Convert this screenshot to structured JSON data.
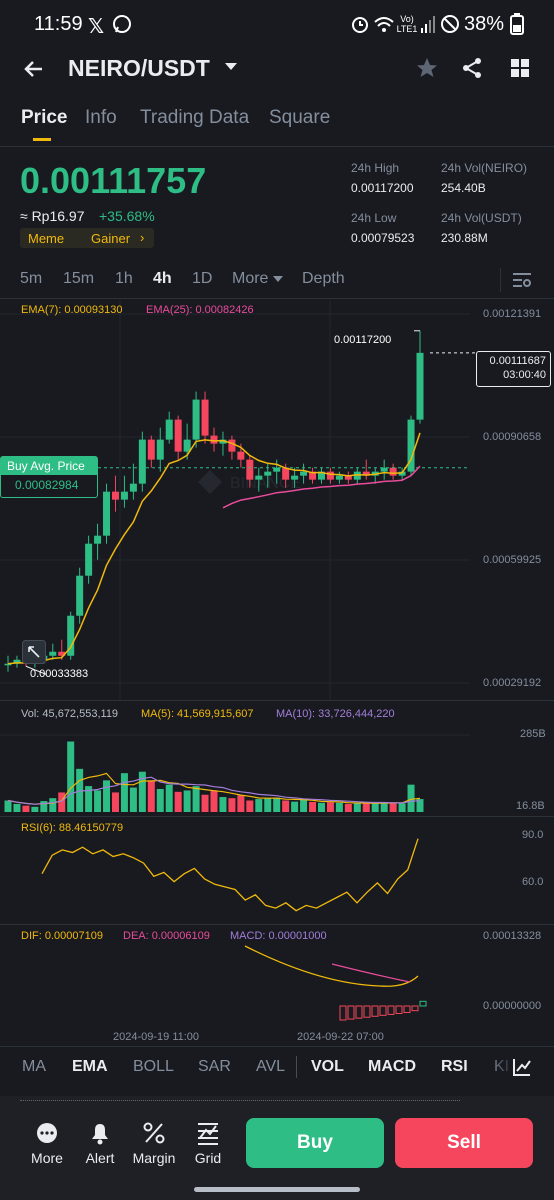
{
  "status_bar": {
    "time": "11:59",
    "net_label": "Vo) LTE1",
    "battery": "38%"
  },
  "header": {
    "pair": "NEIRO/USDT"
  },
  "tabs": [
    "Price",
    "Info",
    "Trading Data",
    "Square"
  ],
  "ticker": {
    "price": "0.00111757",
    "approx": "≈ Rp16.97",
    "change": "+35.68%",
    "tag_meme": "Meme",
    "tag_gainer": "Gainer",
    "high_label": "24h High",
    "high": "0.00117200",
    "vol_base_label": "24h Vol(NEIRO)",
    "vol_base": "254.40B",
    "low_label": "24h Low",
    "low": "0.00079523",
    "vol_quote_label": "24h Vol(USDT)",
    "vol_quote": "230.88M"
  },
  "intervals": [
    "5m",
    "15m",
    "1h",
    "4h",
    "1D",
    "More",
    "Depth"
  ],
  "main_chart": {
    "ema7": "EMA(7): 0.00093130",
    "ema25": "EMA(25): 0.00082426",
    "axis": [
      "0.00121391",
      "0.00090658",
      "0.00059925",
      "0.00029192"
    ],
    "high_marker": "0.00117200",
    "low_marker": "0.00033383",
    "last_price": "0.00111687",
    "countdown": "03:00:40",
    "buy_avg_label": "Buy Avg. Price",
    "buy_avg_value": "0.00082984"
  },
  "volume": {
    "vol": "Vol: 45,672,553,119",
    "ma5": "MA(5): 41,569,915,607",
    "ma10": "MA(10): 33,726,444,220",
    "axis_top": "285B",
    "axis_bottom": "16.8B"
  },
  "rsi": {
    "label": "RSI(6): 88.46150779",
    "axis_top": "90.0",
    "axis_mid": "60.0"
  },
  "macd": {
    "dif": "DIF: 0.00007109",
    "dea": "DEA: 0.00006109",
    "macd": "MACD: 0.00001000",
    "axis_top": "0.00013328",
    "axis_zero": "0.00000000",
    "date1": "2024-09-19 11:00",
    "date2": "2024-09-22 07:00"
  },
  "indicator_tabs": [
    "MA",
    "EMA",
    "BOLL",
    "SAR",
    "AVL",
    "VOL",
    "MACD",
    "RSI",
    "KI"
  ],
  "bottom_nav": [
    "More",
    "Alert",
    "Margin",
    "Grid"
  ],
  "actions": {
    "buy": "Buy",
    "sell": "Sell"
  },
  "colors": {
    "up": "#2ebd85",
    "down": "#f6465d",
    "accent": "#f0b90b",
    "bg": "#181a20"
  },
  "chart_data": {
    "type": "candlestick",
    "y_range": [
      0.00029192,
      0.00121391
    ],
    "candles_olhc": [
      [
        0.00034,
        0.00032,
        0.00036,
        0.00034
      ],
      [
        0.00034,
        0.00033,
        0.00036,
        0.00035
      ],
      [
        0.00035,
        0.00033383,
        0.00037,
        0.00034
      ],
      [
        0.00034,
        0.00033,
        0.00036,
        0.00035
      ],
      [
        0.00035,
        0.00034,
        0.00037,
        0.00036
      ],
      [
        0.00036,
        0.00035,
        0.00039,
        0.00037
      ],
      [
        0.00037,
        0.00035,
        0.0004,
        0.00036
      ],
      [
        0.00036,
        0.00035,
        0.00047,
        0.00046
      ],
      [
        0.00046,
        0.00044,
        0.00058,
        0.00056
      ],
      [
        0.00056,
        0.00054,
        0.00066,
        0.00064
      ],
      [
        0.00064,
        0.0006,
        0.00069,
        0.00066
      ],
      [
        0.00066,
        0.00064,
        0.00079,
        0.00077
      ],
      [
        0.00077,
        0.00072,
        0.00081,
        0.00075
      ],
      [
        0.00075,
        0.00073,
        0.00081,
        0.00077
      ],
      [
        0.00077,
        0.00075,
        0.00084,
        0.00079
      ],
      [
        0.00079,
        0.00077,
        0.00092,
        0.0009
      ],
      [
        0.0009,
        0.00083,
        0.00091,
        0.00085
      ],
      [
        0.00085,
        0.00082,
        0.00093,
        0.0009
      ],
      [
        0.0009,
        0.00089,
        0.00097,
        0.00095
      ],
      [
        0.00095,
        0.00085,
        0.00096,
        0.00087
      ],
      [
        0.00087,
        0.00085,
        0.00094,
        0.0009
      ],
      [
        0.0009,
        0.00088,
        0.00102,
        0.001
      ],
      [
        0.001,
        0.00089,
        0.00102,
        0.00091
      ],
      [
        0.00091,
        0.00087,
        0.00093,
        0.00089
      ],
      [
        0.00089,
        0.00086,
        0.00092,
        0.0009
      ],
      [
        0.0009,
        0.00085,
        0.00091,
        0.00087
      ],
      [
        0.00087,
        0.00083,
        0.00089,
        0.00085
      ],
      [
        0.00085,
        0.00078,
        0.00086,
        0.0008
      ],
      [
        0.0008,
        0.00077,
        0.00083,
        0.00081
      ],
      [
        0.00081,
        0.00078,
        0.00084,
        0.00082
      ],
      [
        0.00082,
        0.00079,
        0.00085,
        0.00083
      ],
      [
        0.00083,
        0.00078,
        0.00084,
        0.0008
      ],
      [
        0.0008,
        0.00078,
        0.00083,
        0.00081
      ],
      [
        0.00081,
        0.00079,
        0.00084,
        0.00082
      ],
      [
        0.00082,
        0.00079,
        0.00083,
        0.0008
      ],
      [
        0.0008,
        0.00079,
        0.00083,
        0.00082
      ],
      [
        0.00082,
        0.00079,
        0.00083,
        0.0008
      ],
      [
        0.0008,
        0.00079,
        0.00082,
        0.00081
      ],
      [
        0.00081,
        0.00079,
        0.00082,
        0.0008
      ],
      [
        0.0008,
        0.00079,
        0.00083,
        0.00082
      ],
      [
        0.00082,
        0.0008,
        0.00085,
        0.00081
      ],
      [
        0.00081,
        0.00079,
        0.00083,
        0.00082
      ],
      [
        0.00082,
        0.0008,
        0.00085,
        0.00083
      ],
      [
        0.00083,
        0.0008,
        0.00084,
        0.00081
      ],
      [
        0.00081,
        0.0008,
        0.00083,
        0.00082
      ],
      [
        0.00082,
        0.00081,
        0.00096,
        0.00095
      ],
      [
        0.00095,
        0.00094,
        0.001172,
        0.00111687
      ]
    ],
    "volumes_B": [
      40,
      28,
      22,
      18,
      38,
      48,
      68,
      245,
      150,
      90,
      75,
      110,
      68,
      135,
      85,
      140,
      110,
      80,
      95,
      70,
      75,
      90,
      60,
      75,
      52,
      48,
      58,
      40,
      45,
      48,
      50,
      40,
      36,
      42,
      35,
      32,
      34,
      32,
      28,
      30,
      32,
      30,
      34,
      32,
      30,
      95,
      45
    ],
    "rsi": [
      62,
      76,
      80,
      78,
      82,
      77,
      80,
      75,
      77,
      74,
      70,
      60,
      63,
      56,
      62,
      66,
      58,
      54,
      52,
      50,
      42,
      46,
      38,
      36,
      40,
      34,
      38,
      36,
      40,
      44,
      48,
      40,
      48,
      55,
      47,
      58,
      65,
      88.46
    ],
    "macd_hist": [
      -3e-05,
      -2.8e-05,
      -2.6e-05,
      -2.4e-05,
      -2.2e-05,
      -2e-05,
      -1.8e-05,
      -1.6e-05,
      -1.4e-05,
      -1e-05,
      1e-05
    ]
  }
}
